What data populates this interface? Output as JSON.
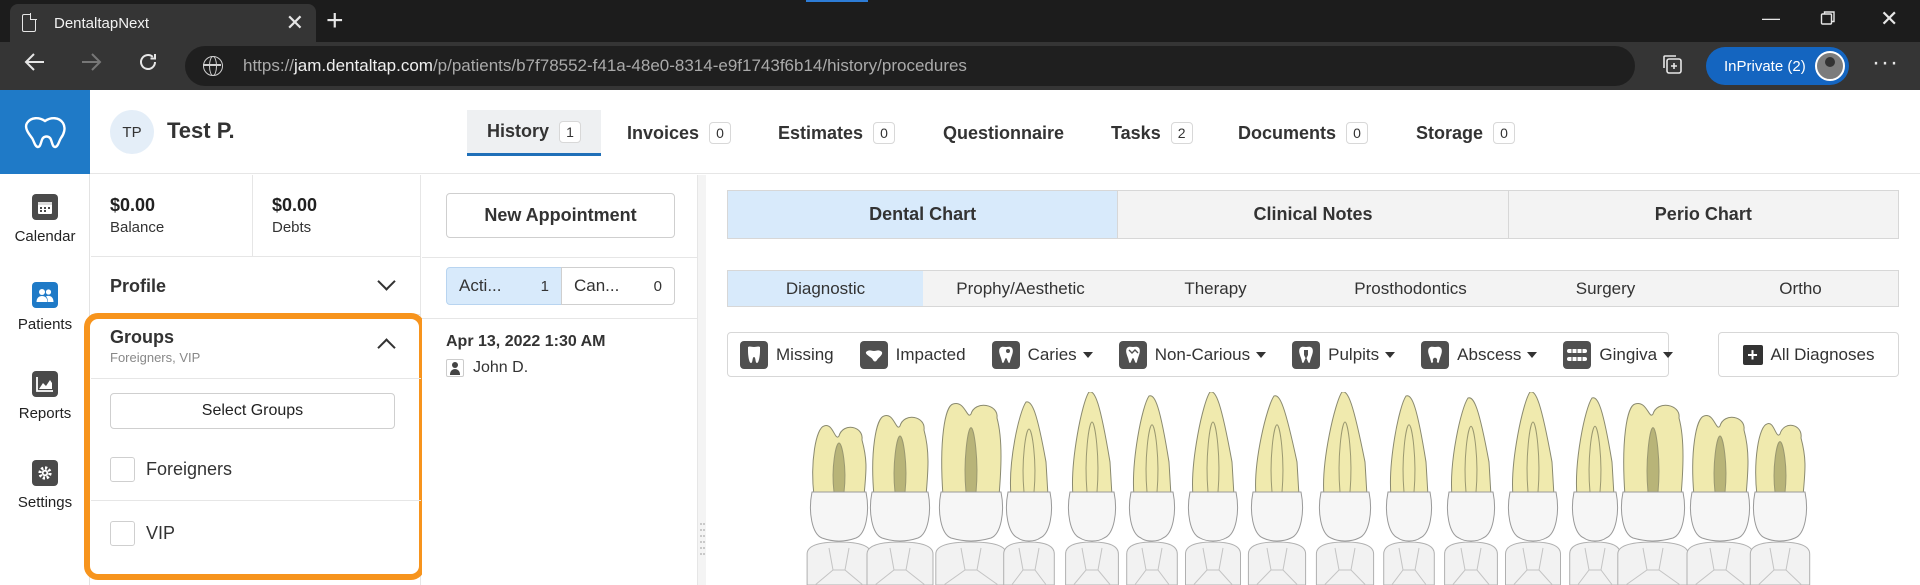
{
  "browser": {
    "tab_title": "DentaltapNext",
    "tab_close": "✕",
    "new_tab": "+",
    "url_scheme": "https://",
    "url_host": "jam.dentaltap.com",
    "url_path": "/p/patients/b7f78552-f41a-48e0-8314-e9f1743f6b14/history/procedures",
    "inprivate_label": "InPrivate (2)"
  },
  "nav": {
    "items": [
      {
        "label": "Calendar",
        "icon": "calendar-icon"
      },
      {
        "label": "Patients",
        "icon": "patients-icon"
      },
      {
        "label": "Reports",
        "icon": "reports-icon"
      },
      {
        "label": "Settings",
        "icon": "settings-icon"
      }
    ]
  },
  "patient": {
    "initials": "TP",
    "name": "Test P."
  },
  "main_tabs": [
    {
      "label": "History",
      "count": "1"
    },
    {
      "label": "Invoices",
      "count": "0"
    },
    {
      "label": "Estimates",
      "count": "0"
    },
    {
      "label": "Questionnaire",
      "count": ""
    },
    {
      "label": "Tasks",
      "count": "2"
    },
    {
      "label": "Documents",
      "count": "0"
    },
    {
      "label": "Storage",
      "count": "0"
    }
  ],
  "summary": {
    "balance": {
      "amount": "$0.00",
      "label": "Balance"
    },
    "debts": {
      "amount": "$0.00",
      "label": "Debts"
    },
    "profile_label": "Profile",
    "groups_label": "Groups",
    "groups_value": "Foreigners, VIP",
    "select_groups": "Select Groups",
    "groups": [
      "Foreigners",
      "VIP"
    ]
  },
  "appointments": {
    "new_button": "New Appointment",
    "filters": [
      {
        "label": "Acti...",
        "count": "1"
      },
      {
        "label": "Can...",
        "count": "0"
      }
    ],
    "items": [
      {
        "date": "Apr 13, 2022 1:30 AM",
        "patient": "John D."
      }
    ]
  },
  "chart_tabs": [
    "Dental Chart",
    "Clinical Notes",
    "Perio Chart"
  ],
  "sub_tabs": [
    "Diagnostic",
    "Prophy/Aesthetic",
    "Therapy",
    "Prosthodontics",
    "Surgery",
    "Ortho"
  ],
  "diagnoses": [
    {
      "label": "Missing",
      "dropdown": false
    },
    {
      "label": "Impacted",
      "dropdown": false
    },
    {
      "label": "Caries",
      "dropdown": true
    },
    {
      "label": "Non-Carious",
      "dropdown": true
    },
    {
      "label": "Pulpits",
      "dropdown": true
    },
    {
      "label": "Abscess",
      "dropdown": true
    },
    {
      "label": "Gingiva",
      "dropdown": true
    }
  ],
  "all_diagnoses": "All Diagnoses",
  "colors": {
    "brand": "#1f7ac7",
    "highlight": "#f7941d",
    "active_tab": "#d8eafb",
    "tooth_crown": "#f0eaae",
    "tooth_root_fill": "#b8b478"
  }
}
